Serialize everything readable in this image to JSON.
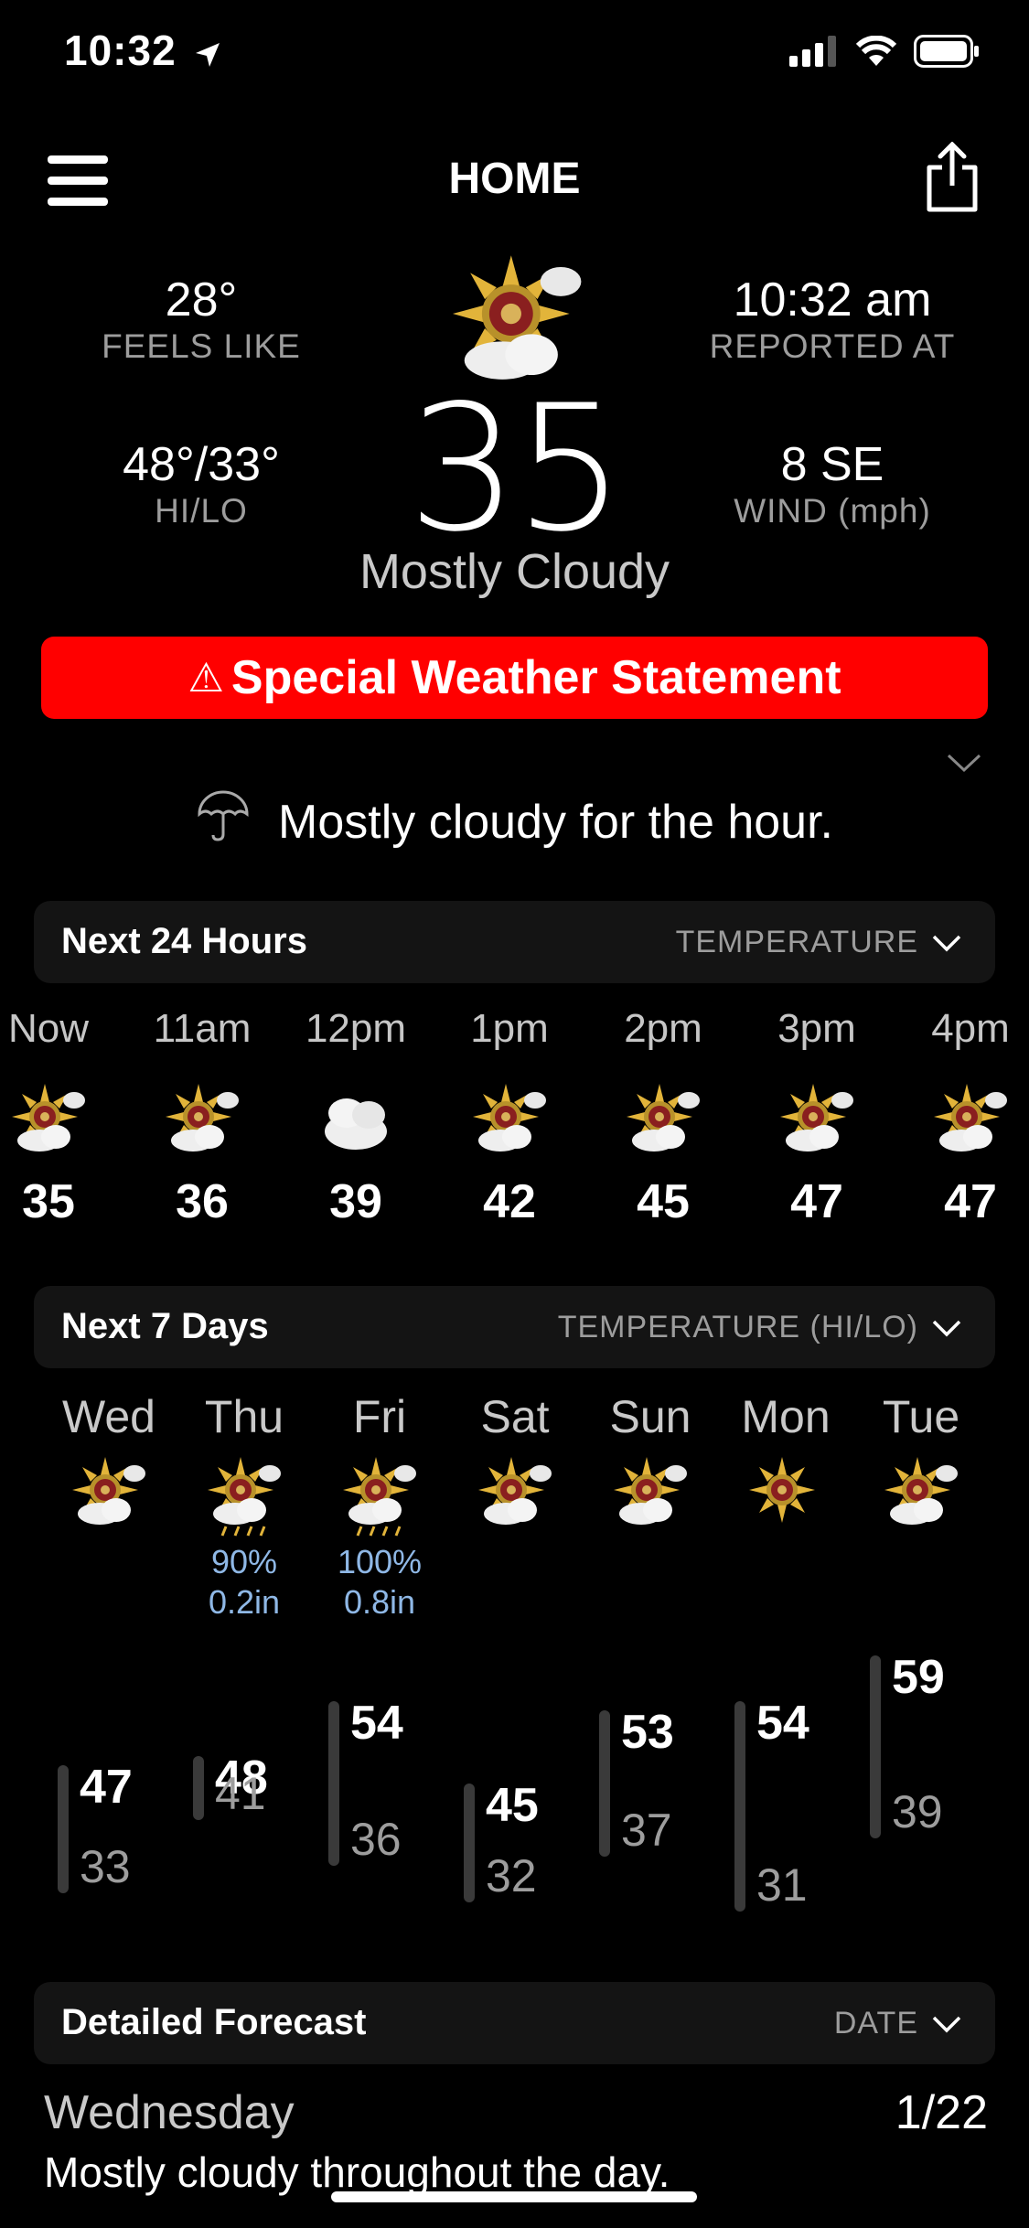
{
  "status": {
    "time": "10:32"
  },
  "header": {
    "title": "HOME"
  },
  "current": {
    "feels_like": {
      "value": "28°",
      "label": "FEELS LIKE"
    },
    "reported": {
      "value": "10:32 am",
      "label": "REPORTED AT"
    },
    "hilo": {
      "value": "48°/33°",
      "label": "HI/LO"
    },
    "wind": {
      "value": "8 SE",
      "label": "WIND (mph)"
    },
    "temp": "35",
    "condition": "Mostly Cloudy"
  },
  "alert": {
    "text": "Special Weather Statement",
    "color": "#ff0000"
  },
  "hour_summary": "Mostly cloudy for the hour.",
  "next24": {
    "title": "Next 24 Hours",
    "selector": "TEMPERATURE",
    "hours": [
      {
        "time": "Now",
        "temp": "35",
        "icon": "sun-cloud-icon"
      },
      {
        "time": "11am",
        "temp": "36",
        "icon": "sun-cloud-icon"
      },
      {
        "time": "12pm",
        "temp": "39",
        "icon": "cloud-icon"
      },
      {
        "time": "1pm",
        "temp": "42",
        "icon": "sun-cloud-icon"
      },
      {
        "time": "2pm",
        "temp": "45",
        "icon": "sun-cloud-icon"
      },
      {
        "time": "3pm",
        "temp": "47",
        "icon": "sun-cloud-icon"
      },
      {
        "time": "4pm",
        "temp": "47",
        "icon": "sun-cloud-icon"
      }
    ]
  },
  "next7": {
    "title": "Next 7 Days",
    "selector": "TEMPERATURE (HI/LO)",
    "days": [
      {
        "day": "Wed",
        "hi": "47",
        "lo": "33",
        "precip": "",
        "amount": "",
        "icon": "sun-cloud-icon"
      },
      {
        "day": "Thu",
        "hi": "48",
        "lo": "41",
        "precip": "90%",
        "amount": "0.2in",
        "icon": "rain-icon"
      },
      {
        "day": "Fri",
        "hi": "54",
        "lo": "36",
        "precip": "100%",
        "amount": "0.8in",
        "icon": "rain-icon"
      },
      {
        "day": "Sat",
        "hi": "45",
        "lo": "32",
        "precip": "",
        "amount": "",
        "icon": "sun-cloud-icon"
      },
      {
        "day": "Sun",
        "hi": "53",
        "lo": "37",
        "precip": "",
        "amount": "",
        "icon": "sun-cloud-icon"
      },
      {
        "day": "Mon",
        "hi": "54",
        "lo": "31",
        "precip": "",
        "amount": "",
        "icon": "sun-icon"
      },
      {
        "day": "Tue",
        "hi": "59",
        "lo": "39",
        "precip": "",
        "amount": "",
        "icon": "sun-cloud-icon"
      }
    ]
  },
  "detailed": {
    "title": "Detailed Forecast",
    "selector": "DATE",
    "items": [
      {
        "day": "Wednesday",
        "date": "1/22",
        "text": "Mostly cloudy throughout the day."
      }
    ]
  }
}
